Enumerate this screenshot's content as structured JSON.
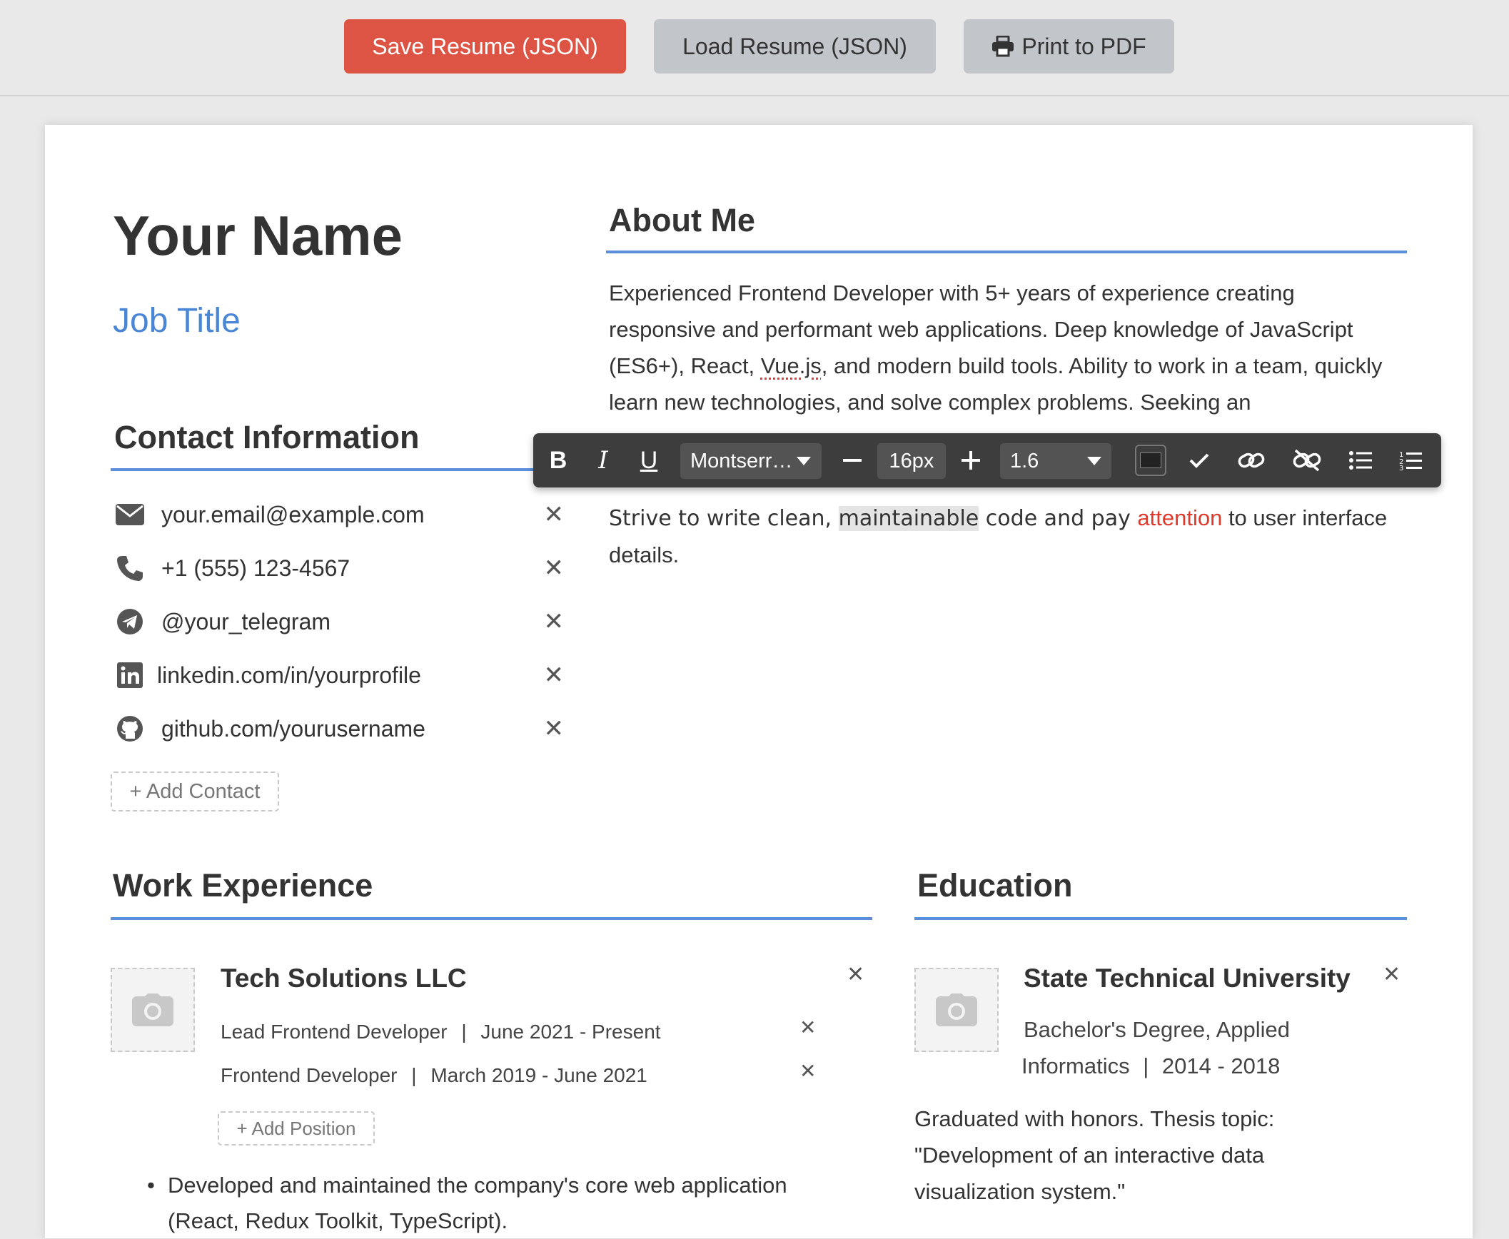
{
  "toolbar": {
    "save_label": "Save Resume (JSON)",
    "load_label": "Load Resume (JSON)",
    "print_label": "Print to PDF"
  },
  "header": {
    "name": "Your Name",
    "job_title": "Job Title"
  },
  "contact": {
    "title": "Contact Information",
    "items": [
      {
        "icon": "envelope-icon",
        "value": "your.email@example.com"
      },
      {
        "icon": "phone-icon",
        "value": "+1 (555) 123-4567"
      },
      {
        "icon": "telegram-icon",
        "value": "@your_telegram"
      },
      {
        "icon": "linkedin-icon",
        "value": "linkedin.com/in/yourprofile"
      },
      {
        "icon": "github-icon",
        "value": "github.com/yourusername"
      }
    ],
    "remove_glyph": "✕",
    "add_label": "+ Add Contact"
  },
  "about": {
    "title": "About Me",
    "paragraph1_a": "Experienced Frontend Developer with 5+ years of experience creating responsive and performant web applications. Deep knowledge of JavaScript (ES6+), React, ",
    "paragraph1_vue": "Vue.js",
    "paragraph1_b": ", and modern build tools. Ability to work in a team, quickly learn new technologies, and solve complex problems. Seeking an",
    "paragraph2_a": "Strive to write clean, ",
    "paragraph2_hl": "maintainable",
    "paragraph2_b": " code and pay ",
    "paragraph2_red": "attention",
    "paragraph2_c": " to user interface details."
  },
  "format_toolbar": {
    "bold": "B",
    "italic": "I",
    "underline": "U",
    "font": "Montserr…",
    "font_size": "16px",
    "line_height": "1.6"
  },
  "work": {
    "title": "Work Experience",
    "company": "Tech Solutions LLC",
    "positions": [
      {
        "role": "Lead Frontend Developer",
        "sep": "|",
        "dates": "June 2021 - Present"
      },
      {
        "role": "Frontend Developer",
        "sep": "|",
        "dates": "March 2019 - June 2021"
      }
    ],
    "add_position_label": "+ Add Position",
    "bullet1": "Developed and maintained the company's core web application",
    "bullet1_cont": "(React, Redux Toolkit, TypeScript)."
  },
  "education": {
    "title": "Education",
    "institution": "State Technical University",
    "degree_line1": "Bachelor's Degree, Applied",
    "degree_line2": "Informatics",
    "sep": "|",
    "years": "2014 - 2018",
    "description": "Graduated with honors. Thesis topic: \"Development of an interactive data visualization system.\""
  },
  "colors": {
    "accent": "#4a86d6",
    "save_button": "#dd5444",
    "secondary_button": "#c2c6cb",
    "toolbar_bg": "#3d3d3d",
    "highlight_text": "#e0382a"
  }
}
